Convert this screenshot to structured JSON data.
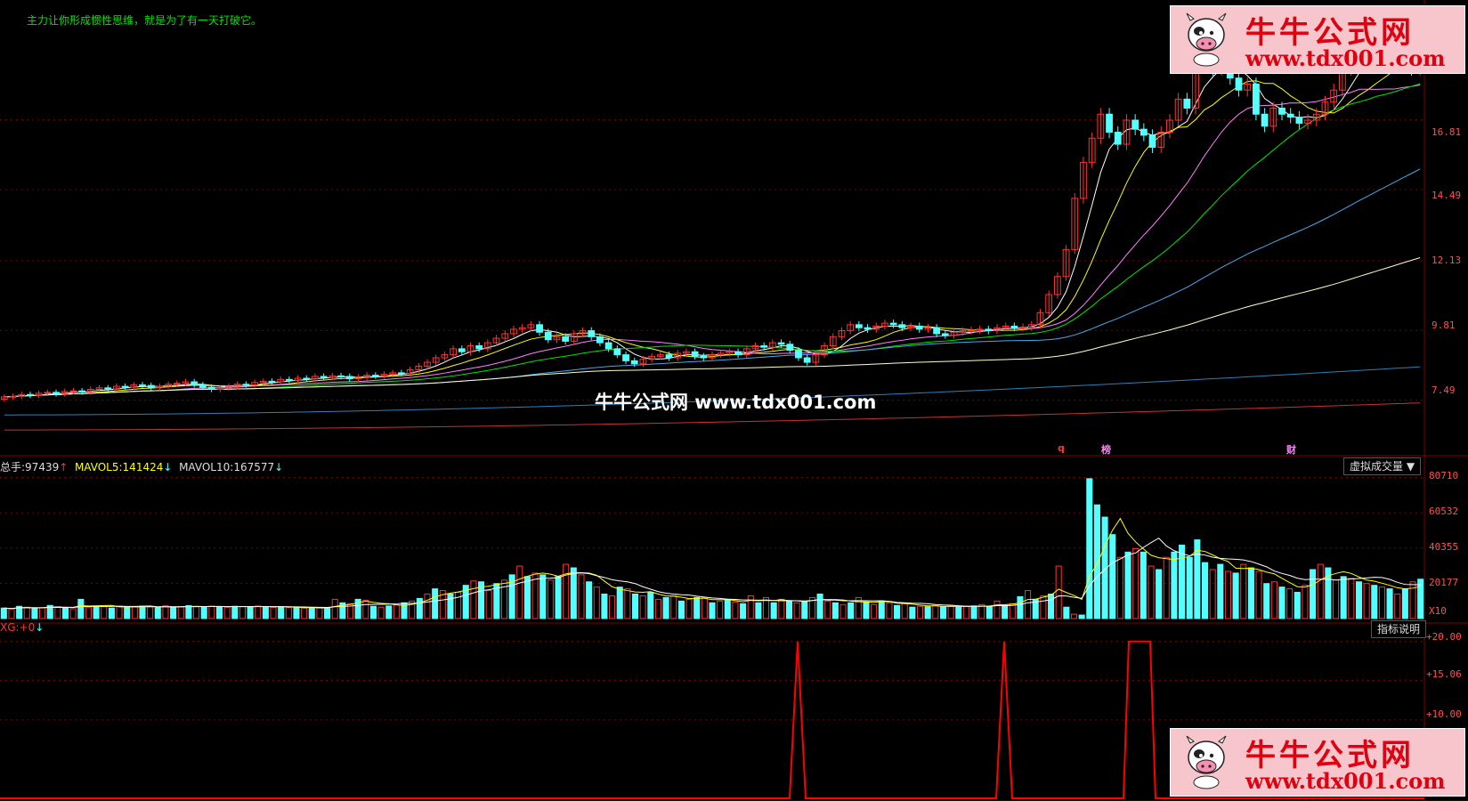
{
  "top_banner": "主力让你形成惯性思维，就是为了有一天打破它。",
  "watermark_center": "牛牛公式网 www.tdx001.com",
  "logo": {
    "title": "牛牛公式网",
    "url": "www.tdx001.com"
  },
  "price_axis": [
    "16.81",
    "14.49",
    "12.13",
    "9.81",
    "7.49"
  ],
  "markers": {
    "q": "q",
    "bang": "榜",
    "cai": "财"
  },
  "volume_header": {
    "total_label": "总手:",
    "total_value": "97439",
    "total_arrow": "↑",
    "mavol5_label": "MAVOL5:",
    "mavol5_value": "141424",
    "mavol5_arrow": "↓",
    "mavol10_label": "MAVOL10:",
    "mavol10_value": "167577",
    "mavol10_arrow": "↓"
  },
  "volume_button": "虚拟成交量 ▼",
  "volume_axis": [
    "80710",
    "60532",
    "40355",
    "20177",
    "X10"
  ],
  "indicator_header": {
    "label": "XG:",
    "value": "+0",
    "arrow": "↓"
  },
  "indicator_button": "指标说明",
  "indicator_axis": [
    "+20.00",
    "+15.06",
    "+10.00"
  ],
  "colors": {
    "up": "#ff3232",
    "down": "#54ffff",
    "grid": "#800000",
    "ma5": "#ffffff",
    "ma10": "#ffff00",
    "ma20": "#ff80ff",
    "ma30": "#00e600",
    "ma60": "#4aa8e8",
    "ma120": "#ffffc8",
    "ma250": "#2f7fb8",
    "ma500": "#c83232",
    "signal": "#ff0000"
  },
  "chart_data": [
    {
      "type": "candlestick",
      "ylim": [
        6.0,
        20.5
      ],
      "y_ticks": [
        7.49,
        9.81,
        12.13,
        14.49,
        16.81
      ],
      "candles_close": [
        7.6,
        7.62,
        7.68,
        7.65,
        7.72,
        7.75,
        7.7,
        7.78,
        7.8,
        7.76,
        7.85,
        7.9,
        7.86,
        7.95,
        7.92,
        8.0,
        7.98,
        7.9,
        7.95,
        8.02,
        8.05,
        8.1,
        8.0,
        7.92,
        7.85,
        7.9,
        7.95,
        8.02,
        8.0,
        8.08,
        8.12,
        8.1,
        8.18,
        8.15,
        8.22,
        8.2,
        8.28,
        8.25,
        8.3,
        8.28,
        8.2,
        8.25,
        8.32,
        8.3,
        8.35,
        8.4,
        8.38,
        8.5,
        8.62,
        8.75,
        8.9,
        9.0,
        9.2,
        9.1,
        9.3,
        9.2,
        9.4,
        9.55,
        9.7,
        9.85,
        9.9,
        10.0,
        9.75,
        9.5,
        9.6,
        9.45,
        9.7,
        9.8,
        9.6,
        9.4,
        9.2,
        9.0,
        8.8,
        8.7,
        8.85,
        8.95,
        9.0,
        8.9,
        9.05,
        9.1,
        8.95,
        8.9,
        9.0,
        9.05,
        9.1,
        9.0,
        9.2,
        9.3,
        9.25,
        9.4,
        9.35,
        9.15,
        8.9,
        8.75,
        9.0,
        9.3,
        9.6,
        9.8,
        10.0,
        9.9,
        9.85,
        9.95,
        10.05,
        10.0,
        9.9,
        9.95,
        9.85,
        9.9,
        9.7,
        9.65,
        9.75,
        9.8,
        9.82,
        9.85,
        9.8,
        9.9,
        9.95,
        9.9,
        9.92,
        10.0,
        10.4,
        11.0,
        11.6,
        12.5,
        14.2,
        15.4,
        16.2,
        17.0,
        16.4,
        16.0,
        16.8,
        16.5,
        16.3,
        15.9,
        16.4,
        16.8,
        17.5,
        17.2,
        18.8,
        19.2,
        18.5,
        18.9,
        18.2,
        17.8,
        18.0,
        17.0,
        16.6,
        17.2,
        17.0,
        16.9,
        16.7,
        16.8,
        17.0,
        17.4,
        17.8,
        18.5,
        19.0,
        19.3,
        18.8,
        19.1,
        18.7,
        18.9,
        19.2,
        18.5,
        19.0
      ],
      "ma": {
        "MA5": "short moving average",
        "MA10": "moving average",
        "MA20": "moving average",
        "MA30": "moving average",
        "MA60": "moving average",
        "MA120": "moving average",
        "MA250": "moving average",
        "MA500": "moving average"
      }
    },
    {
      "type": "bar",
      "ylim": [
        0,
        85000
      ],
      "y_ticks": [
        20177,
        40355,
        60532,
        80710
      ],
      "values": [
        6000,
        5500,
        7000,
        6500,
        5800,
        6200,
        7500,
        6800,
        6000,
        5600,
        11000,
        6500,
        7200,
        6800,
        6000,
        7000,
        6400,
        6900,
        7100,
        6700,
        6200,
        7300,
        6500,
        6900,
        7400,
        6800,
        6600,
        7100,
        6900,
        6500,
        7000,
        6800,
        6600,
        7200,
        6900,
        6400,
        6700,
        6300,
        6200,
        5900,
        6100,
        6000,
        5800,
        11000,
        9000,
        8500,
        11000,
        10500,
        7000,
        6500,
        7200,
        7800,
        9000,
        10000,
        11500,
        14000,
        17000,
        16000,
        14000,
        15000,
        19000,
        21500,
        21000,
        16000,
        20000,
        22000,
        25000,
        30000,
        24000,
        26000,
        25000,
        22000,
        24000,
        31000,
        29000,
        25000,
        21000,
        18000,
        14000,
        13000,
        18000,
        17000,
        14000,
        13000,
        15000,
        11000,
        12000,
        13000,
        10000,
        11000,
        12000,
        12000,
        9000,
        10000,
        11000,
        9500,
        8500,
        13000,
        9000,
        12000,
        9000,
        11000,
        10000,
        9000,
        9500,
        12000,
        14000,
        10000,
        9000,
        8000,
        9000,
        12000,
        9500,
        8000,
        10000,
        9000,
        7500,
        8500,
        6500,
        7000,
        6800,
        7500,
        6800,
        7000,
        6500,
        6800,
        7200,
        8000,
        7000,
        10000,
        7500,
        8500,
        12500,
        16000,
        11000,
        13000,
        14000,
        30000,
        6500,
        2500,
        2000,
        80000,
        65000,
        58000,
        48000,
        35000,
        38000,
        40000,
        38000,
        30000,
        28000,
        35000,
        38000,
        42000,
        35000,
        45000,
        32000,
        28000,
        31000,
        27000,
        26000,
        31000,
        29000,
        27000,
        20000,
        21000,
        18000,
        17000,
        15000,
        19000,
        28000,
        31000,
        29000,
        22000,
        24000,
        23000,
        21000,
        20000,
        19000,
        18000,
        17000,
        14000,
        17000,
        21000,
        22500
      ],
      "series": [
        {
          "name": "MAVOL5"
        },
        {
          "name": "MAVOL10"
        }
      ]
    },
    {
      "type": "line",
      "ylim": [
        0,
        21
      ],
      "y_ticks": [
        10.0,
        15.06,
        20.0
      ],
      "spikes_at_fraction": [
        0.56,
        0.705,
        0.8
      ],
      "value": 20
    }
  ]
}
